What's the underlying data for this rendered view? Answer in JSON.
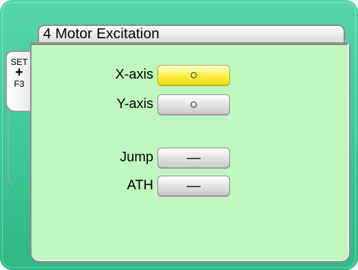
{
  "header": {
    "title": "4 Motor Excitation"
  },
  "side_tab": {
    "line1": "SET",
    "plus": "+",
    "line2": "F3"
  },
  "rows": [
    {
      "label": "X-axis",
      "value": "○",
      "selected": true
    },
    {
      "label": "Y-axis",
      "value": "○",
      "selected": false
    },
    {
      "label": "Jump",
      "value": "—",
      "selected": false
    },
    {
      "label": "ATH",
      "value": "—",
      "selected": false
    }
  ],
  "colors": {
    "frame": "#3fc89a",
    "panel": "#bff7bf",
    "selected": "#f3e200"
  }
}
